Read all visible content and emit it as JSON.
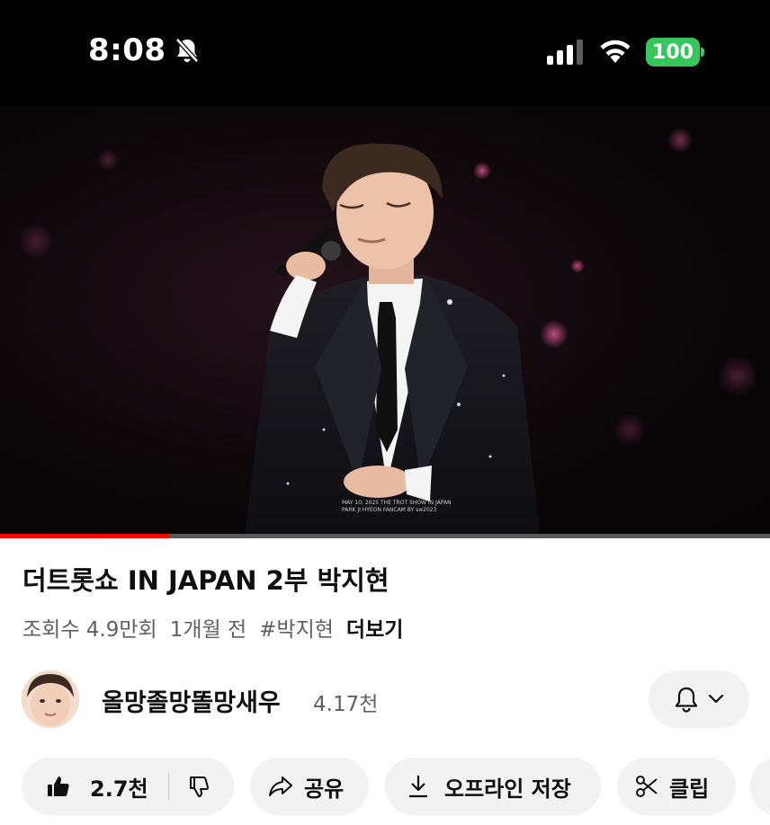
{
  "status_bar": {
    "time": "8:08",
    "battery": "100",
    "battery_color": "#34c759",
    "icons": [
      "bell-off-icon",
      "signal-icon",
      "wifi-icon",
      "battery-icon"
    ]
  },
  "video": {
    "watermark_line1": "MAY 10, 2025 THE TROT SHOW IN JAPAN",
    "watermark_line2": "PARK JI HYEON FANCAM BY sw2023",
    "progress": 0.22,
    "progress_color": "#ff0000"
  },
  "info": {
    "title": "더트롯쇼 IN JAPAN 2부 박지현",
    "views": "조회수 4.9만회",
    "age": "1개월 전",
    "hashtag": "#박지현",
    "more": "더보기"
  },
  "channel": {
    "name": "올망졸망똘망새우",
    "subscribers": "4.17천"
  },
  "actions": {
    "likes": "2.7천",
    "share": "공유",
    "offline": "오프라인 저장",
    "clip": "클립"
  }
}
